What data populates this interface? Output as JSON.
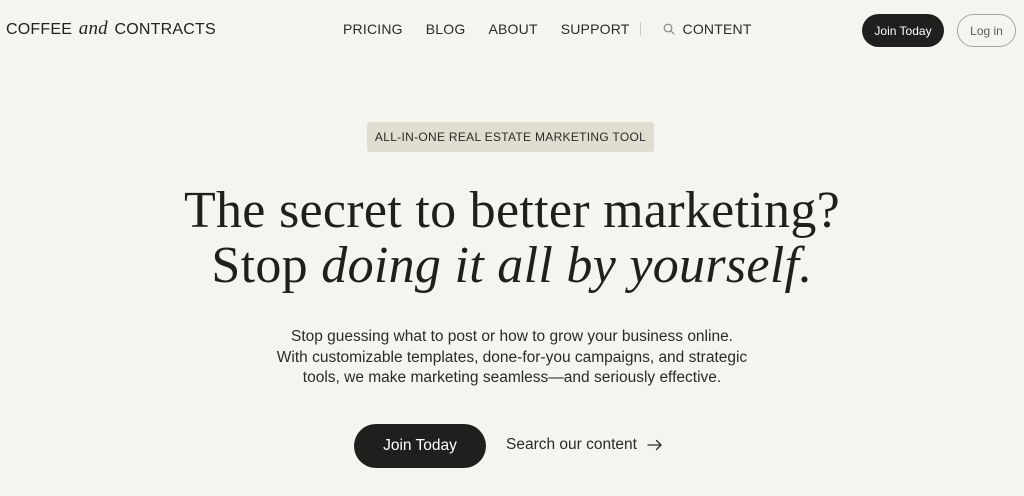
{
  "header": {
    "logo": {
      "left": "COFFEE",
      "middle": "and",
      "right": "CONTRACTS"
    },
    "nav": {
      "pricing": "PRICING",
      "blog": "BLOG",
      "about": "ABOUT",
      "support": "SUPPORT",
      "content": "CONTENT",
      "search_icon": "search-icon"
    },
    "join_label": "Join Today",
    "login_label": "Log in"
  },
  "hero": {
    "badge": "ALL-IN-ONE REAL ESTATE MARKETING TOOL",
    "headline_line1": "The secret to better marketing?",
    "headline_line2_plain": "Stop ",
    "headline_line2_italic": "doing it all by yourself.",
    "subtext": [
      "Stop guessing what to post or how to grow your business online.",
      "With customizable templates, done-for-you campaigns, and strategic",
      "tools, we make marketing seamless—and seriously effective."
    ],
    "cta_primary": "Join Today",
    "cta_secondary": "Search our content",
    "cta_secondary_icon": "arrow-right-icon"
  },
  "colors": {
    "background": "#f5f4ef",
    "text": "#1f1f1d",
    "button_dark": "#1f1f1d",
    "badge_bg": "#e0ddd1"
  }
}
